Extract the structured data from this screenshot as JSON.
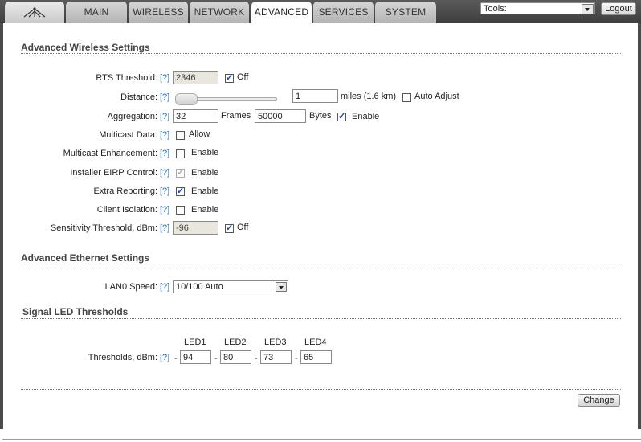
{
  "nav": {
    "tabs": [
      "MAIN",
      "WIRELESS",
      "NETWORK",
      "ADVANCED",
      "SERVICES",
      "SYSTEM"
    ],
    "active": "ADVANCED",
    "tools_label": "Tools:",
    "logout": "Logout"
  },
  "wireless": {
    "title": "Advanced Wireless Settings",
    "help": "[?]",
    "rts_label": "RTS Threshold:",
    "rts_value": "2346",
    "rts_off_checked": true,
    "off": "Off",
    "distance_label": "Distance:",
    "distance_value": "1",
    "distance_unit": "miles (1.6 km)",
    "auto_adjust": "Auto Adjust",
    "auto_adjust_checked": false,
    "aggregation_label": "Aggregation:",
    "aggregation_frames": "32",
    "frames": "Frames",
    "aggregation_bytes": "50000",
    "bytes": "Bytes",
    "aggregation_enable_checked": true,
    "enable": "Enable",
    "multicast_data_label": "Multicast Data:",
    "allow": "Allow",
    "multicast_data_checked": false,
    "multicast_enh_label": "Multicast Enhancement:",
    "multicast_enh_checked": false,
    "eirp_label": "Installer EIRP Control:",
    "eirp_checked": true,
    "extra_label": "Extra Reporting:",
    "extra_checked": true,
    "isolation_label": "Client Isolation:",
    "isolation_checked": false,
    "sensitivity_label": "Sensitivity Threshold, dBm:",
    "sensitivity_value": "-96",
    "sensitivity_off_checked": true
  },
  "ethernet": {
    "title": "Advanced Ethernet Settings",
    "lan0_label": "LAN0 Speed:",
    "lan0_value": "10/100 Auto"
  },
  "led": {
    "title": "Signal LED Thresholds",
    "headers": [
      "LED1",
      "LED2",
      "LED3",
      "LED4"
    ],
    "thresholds_label": "Thresholds, dBm:",
    "dash": "-",
    "values": [
      "94",
      "80",
      "73",
      "65"
    ]
  },
  "change": "Change"
}
